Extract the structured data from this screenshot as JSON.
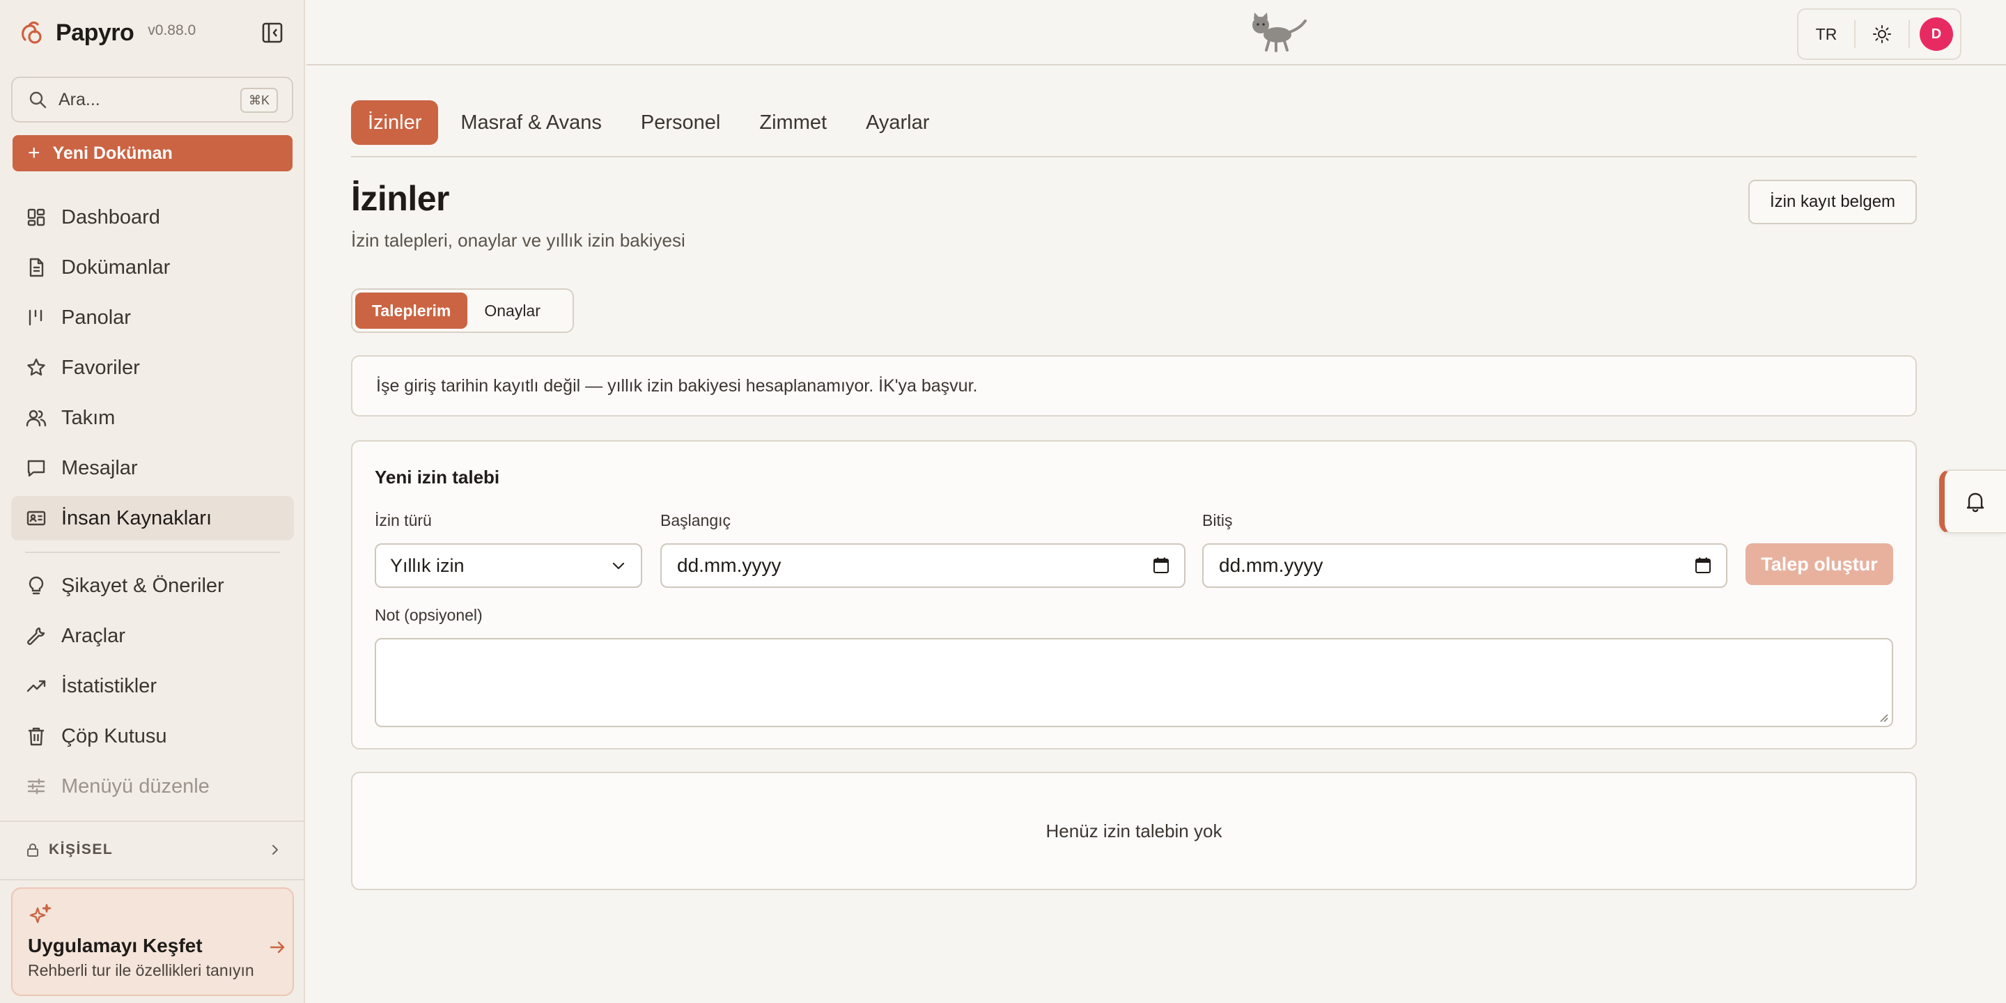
{
  "app": {
    "name": "Papyro",
    "version": "v0.88.0"
  },
  "search": {
    "placeholder": "Ara...",
    "shortcut": "⌘K"
  },
  "new_doc": {
    "label": "Yeni Doküman"
  },
  "nav": {
    "items": [
      {
        "label": "Dashboard",
        "icon": "dashboard-icon"
      },
      {
        "label": "Dokümanlar",
        "icon": "document-icon"
      },
      {
        "label": "Panolar",
        "icon": "board-icon"
      },
      {
        "label": "Favoriler",
        "icon": "star-icon"
      },
      {
        "label": "Takım",
        "icon": "team-icon"
      },
      {
        "label": "Mesajlar",
        "icon": "message-icon"
      },
      {
        "label": "İnsan Kaynakları",
        "icon": "id-card-icon",
        "active": true
      }
    ],
    "items2": [
      {
        "label": "Şikayet & Öneriler",
        "icon": "lightbulb-icon"
      },
      {
        "label": "Araçlar",
        "icon": "wrench-icon"
      },
      {
        "label": "İstatistikler",
        "icon": "trending-icon"
      },
      {
        "label": "Çöp Kutusu",
        "icon": "trash-icon"
      },
      {
        "label": "Menüyü düzenle",
        "icon": "sliders-icon"
      }
    ],
    "personal_label": "KİŞİSEL"
  },
  "explore": {
    "title": "Uygulamayı Keşfet",
    "subtitle": "Rehberli tur ile özellikleri tanıyın"
  },
  "topbar": {
    "lang": "TR",
    "avatar_initial": "D",
    "avatar_color": "#e82a62"
  },
  "tabs": [
    "İzinler",
    "Masraf & Avans",
    "Personel",
    "Zimmet",
    "Ayarlar"
  ],
  "page": {
    "title": "İzinler",
    "subtitle": "İzin talepleri, onaylar ve yıllık izin bakiyesi",
    "record_button": "İzin kayıt belgem"
  },
  "segments": [
    "Taleplerim",
    "Onaylar"
  ],
  "info_message": "İşe giriş tarihin kayıtlı değil — yıllık izin bakiyesi hesaplanamıyor. İK'ya başvur.",
  "form": {
    "title": "Yeni izin talebi",
    "type_label": "İzin türü",
    "type_value": "Yıllık izin",
    "start_label": "Başlangıç",
    "start_value": "dd.mm.yyyy",
    "end_label": "Bitiş",
    "end_value": "dd.mm.yyyy",
    "submit_label": "Talep oluştur",
    "note_label": "Not (opsiyonel)",
    "note_value": ""
  },
  "empty_message": "Henüz izin talebin yok",
  "colors": {
    "accent": "#cb6443",
    "accent_disabled": "#e8b19e",
    "sidebar_bg": "#f2ede7",
    "page_bg": "#f7f5f1"
  }
}
